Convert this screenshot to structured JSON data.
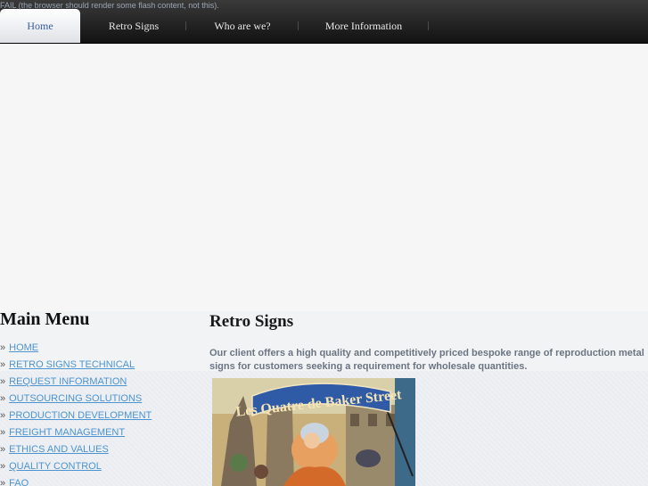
{
  "flash_fallback": "FAIL (the browser should render some flash content, not this).",
  "nav": {
    "items": [
      {
        "label": "Home",
        "active": true
      },
      {
        "label": "Retro Signs",
        "active": false
      },
      {
        "label": "Who are we?",
        "active": false
      },
      {
        "label": "More Information",
        "active": false
      }
    ]
  },
  "sidebar": {
    "title": "Main Menu",
    "bullet": "»",
    "items": [
      {
        "label": "HOME"
      },
      {
        "label": "RETRO SIGNS TECHNICAL"
      },
      {
        "label": "REQUEST INFORMATION"
      },
      {
        "label": "OUTSOURCING SOLUTIONS"
      },
      {
        "label": "PRODUCTION DEVELOPMENT"
      },
      {
        "label": "FREIGHT MANAGEMENT"
      },
      {
        "label": "ETHICS AND VALUES"
      },
      {
        "label": "QUALITY CONTROL"
      },
      {
        "label": "FAQ"
      }
    ]
  },
  "content": {
    "title": "Retro Signs",
    "body": "Our client offers a high quality and competitively priced bespoke range of reproduction metal signs for customers seeking a requirement for wholesale quantities.",
    "poster_text": "Les Quatre de Baker Street"
  },
  "colors": {
    "link": "#4d94d0",
    "nav_bg": "#1a1a1a",
    "active_tab_text": "#3a5ea0"
  }
}
